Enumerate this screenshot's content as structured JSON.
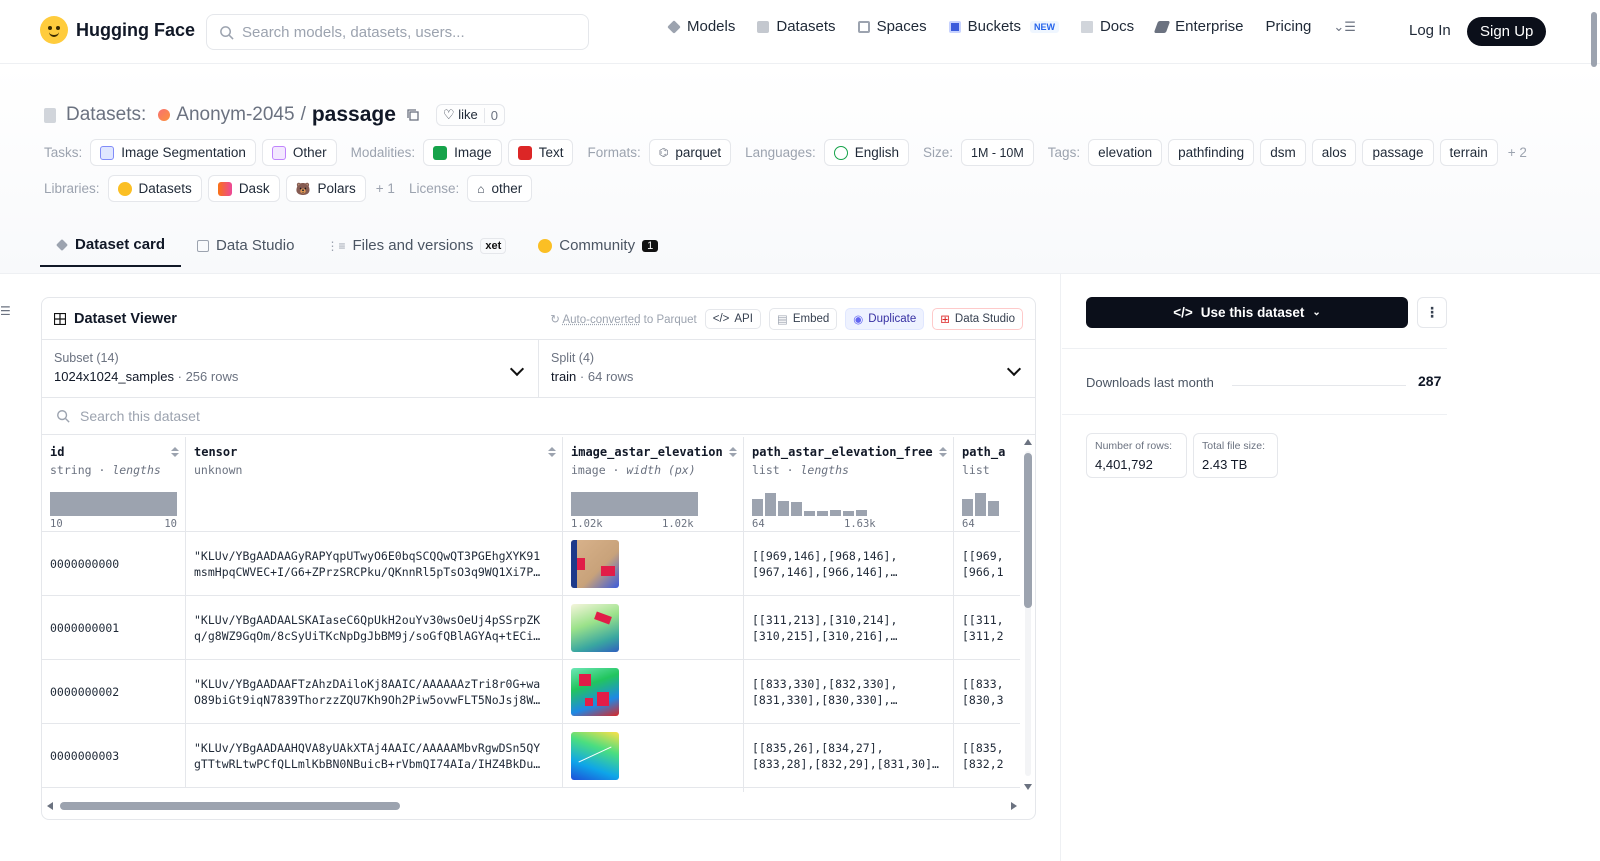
{
  "brand": {
    "name": "Hugging Face"
  },
  "search": {
    "placeholder": "Search models, datasets, users..."
  },
  "nav": {
    "models": "Models",
    "datasets": "Datasets",
    "spaces": "Spaces",
    "buckets": "Buckets",
    "buckets_badge": "NEW",
    "docs": "Docs",
    "enterprise": "Enterprise",
    "pricing": "Pricing",
    "login": "Log In",
    "signup": "Sign Up"
  },
  "repo": {
    "section": "Datasets:",
    "owner": "Anonym-2045",
    "sep": "/",
    "name": "passage",
    "like_label": "like",
    "like_count": "0"
  },
  "tags": {
    "tasks_label": "Tasks:",
    "task_1": "Image Segmentation",
    "task_2": "Other",
    "modalities_label": "Modalities:",
    "modality_1": "Image",
    "modality_2": "Text",
    "formats_label": "Formats:",
    "format_1": "parquet",
    "languages_label": "Languages:",
    "language_1": "English",
    "size_label": "Size:",
    "size_1": "1M - 10M",
    "tags_label": "Tags:",
    "tag_1": "elevation",
    "tag_2": "pathfinding",
    "tag_3": "dsm",
    "tag_4": "alos",
    "tag_5": "passage",
    "tag_6": "terrain",
    "tags_more": "+ 2",
    "libraries_label": "Libraries:",
    "library_1": "Datasets",
    "library_2": "Dask",
    "library_3": "Polars",
    "libraries_more": "+ 1",
    "license_label": "License:",
    "license_1": "other"
  },
  "tabs": {
    "card": "Dataset card",
    "studio": "Data Studio",
    "files": "Files and versions",
    "files_badge": "xet",
    "community": "Community",
    "community_count": "1"
  },
  "viewer": {
    "title": "Dataset Viewer",
    "autoconv_link": "Auto-converted",
    "autoconv_rest": " to Parquet",
    "api": "API",
    "embed": "Embed",
    "duplicate": "Duplicate",
    "data_studio": "Data Studio",
    "subset_caption": "Subset (14)",
    "subset_value": "1024x1024_samples",
    "subset_rows": "256 rows",
    "split_caption": "Split (4)",
    "split_value": "train",
    "split_rows": "64 rows",
    "search_placeholder": "Search this dataset",
    "dot": "·"
  },
  "columns": [
    {
      "name": "id",
      "type": "string",
      "stat": "lengths",
      "min": "10",
      "max": "10"
    },
    {
      "name": "tensor",
      "type": "unknown",
      "stat": "",
      "min": "",
      "max": ""
    },
    {
      "name": "image_astar_elevation",
      "type": "image",
      "stat": "width (px)",
      "min": "1.02k",
      "max": "1.02k"
    },
    {
      "name": "path_astar_elevation_free",
      "type": "list",
      "stat": "lengths",
      "min": "64",
      "max": "1.63k"
    },
    {
      "name": "path_a",
      "type": "list",
      "stat": "",
      "min": "64",
      "max": ""
    }
  ],
  "histogram": {
    "bins": [
      0.72,
      0.95,
      0.62,
      0.58,
      0.22,
      0.22,
      0.25,
      0.22,
      0.25
    ]
  },
  "histogram_clip": {
    "bins": [
      0.72,
      0.95,
      0.62
    ]
  },
  "rows": [
    {
      "id": "0000000000",
      "tensor_1": "\"KLUv/YBgAADAAGyRAPYqpUTwyO6E0bqSCQQwQT3PGEhgXYK91",
      "tensor_2": "msmHpqCWVEC+I/G6+ZPrzSRCPku/QKnnRl5pTsO3q9WQ1Xi7P…",
      "path_1": "[[969,146],[968,146],",
      "path_2": "[967,146],[966,146],…",
      "clip_1": "[[969,",
      "clip_2": "[966,1"
    },
    {
      "id": "0000000001",
      "tensor_1": "\"KLUv/YBgAADAALSKAIaseC6QpUkH2ouYv30wsOeUj4pSSrpZK",
      "tensor_2": "q/g8WZ9GqOm/8cSyUiTKcNpDgJbBM9j/soGfQBlAGYAq+tECi…",
      "path_1": "[[311,213],[310,214],",
      "path_2": "[310,215],[310,216],…",
      "clip_1": "[[311,",
      "clip_2": "[311,2"
    },
    {
      "id": "0000000002",
      "tensor_1": "\"KLUv/YBgAADAAFTzAhzDAiloKj8AAIC/AAAAAAzTri8r0G+wa",
      "tensor_2": "O89biGt9iqN7839ThorzzZQU7Kh9Oh2Piw5ovwFLT5NoJsj8W…",
      "path_1": "[[833,330],[832,330],",
      "path_2": "[831,330],[830,330],…",
      "clip_1": "[[833,",
      "clip_2": "[830,3"
    },
    {
      "id": "0000000003",
      "tensor_1": "\"KLUv/YBgAADAAHQVA8yUAkXTAj4AAIC/AAAAAMbvRgwDSn5QY",
      "tensor_2": "gTTtwRLtwPCfQLLmlKbBN0NBuicB+rVbmQI74AIa/IHZ4BkDu…",
      "path_1": "[[835,26],[834,27],",
      "path_2": "[833,28],[832,29],[831,30]…",
      "clip_1": "[[835,",
      "clip_2": "[832,2"
    }
  ],
  "sidebar": {
    "use_dataset": "Use this dataset",
    "downloads_label": "Downloads last month",
    "downloads_value": "287",
    "rows_label": "Number of rows:",
    "rows_value": "4,401,792",
    "size_label": "Total file size:",
    "size_value": "2.43 TB"
  },
  "colors": {
    "accent_dark": "#0b0f1a",
    "border": "#e5e7eb",
    "hist": "#9ca3af"
  }
}
